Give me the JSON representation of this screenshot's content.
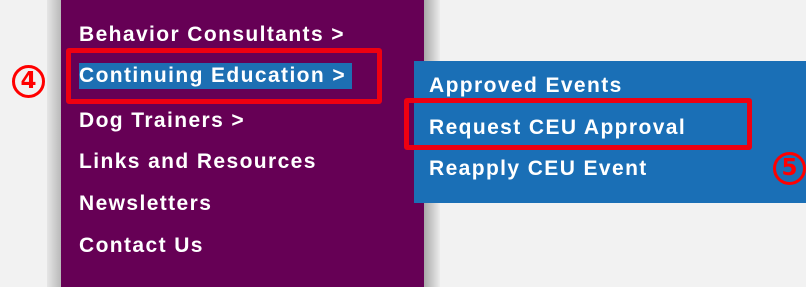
{
  "nav_menu": {
    "items": [
      {
        "label": "Behavior Consultants  >"
      },
      {
        "label": "Continuing Education  >"
      },
      {
        "label": "Dog Trainers  >"
      },
      {
        "label": "Links and Resources"
      },
      {
        "label": "Newsletters"
      },
      {
        "label": "Contact Us"
      }
    ]
  },
  "submenu": {
    "items": [
      {
        "label": "Approved Events"
      },
      {
        "label": "Request CEU Approval"
      },
      {
        "label": "Reapply CEU Event"
      }
    ]
  },
  "annotations": {
    "step_4": "4",
    "step_5": "5"
  },
  "colors": {
    "menu_background": "#660055",
    "submenu_background": "#1a6fb6",
    "highlight_red": "#ee0011"
  }
}
